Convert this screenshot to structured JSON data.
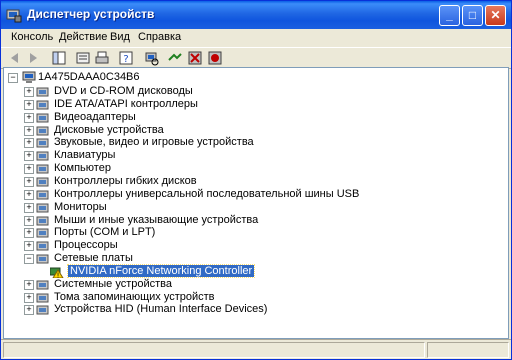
{
  "window": {
    "title": "Диспетчер устройств"
  },
  "menu": [
    "Консоль",
    "Действие",
    "Вид",
    "Справка"
  ],
  "toolbar": [
    "back-icon",
    "forward-icon",
    "console-tree-icon",
    "properties-icon",
    "print-icon",
    "help-icon",
    "scan-hardware-icon",
    "update-driver-icon",
    "disable-device-icon",
    "uninstall-device-icon"
  ],
  "tree": {
    "root": "1A475DAAA0C34B6",
    "items": [
      {
        "label": "DVD и CD-ROM дисководы",
        "icon": "dvd-icon"
      },
      {
        "label": "IDE ATA/ATAPI контроллеры",
        "icon": "ide-controller-icon"
      },
      {
        "label": "Видеоадаптеры",
        "icon": "display-adapter-icon"
      },
      {
        "label": "Дисковые устройства",
        "icon": "disk-drive-icon"
      },
      {
        "label": "Звуковые, видео и игровые устройства",
        "icon": "sound-icon"
      },
      {
        "label": "Клавиатуры",
        "icon": "keyboard-icon"
      },
      {
        "label": "Компьютер",
        "icon": "computer-icon"
      },
      {
        "label": "Контроллеры гибких дисков",
        "icon": "floppy-controller-icon"
      },
      {
        "label": "Контроллеры универсальной последовательной шины USB",
        "icon": "usb-icon"
      },
      {
        "label": "Мониторы",
        "icon": "monitor-icon"
      },
      {
        "label": "Мыши и иные указывающие устройства",
        "icon": "mouse-icon"
      },
      {
        "label": "Порты (COM и LPT)",
        "icon": "port-icon"
      },
      {
        "label": "Процессоры",
        "icon": "processor-icon"
      },
      {
        "label": "Сетевые платы",
        "icon": "network-adapter-icon",
        "expanded": true
      },
      {
        "label": "NVIDIA nForce Networking Controller",
        "icon": "warning-device-icon",
        "child": true,
        "selected": true
      },
      {
        "label": "Системные устройства",
        "icon": "system-device-icon"
      },
      {
        "label": "Тома запоминающих устройств",
        "icon": "storage-volume-icon"
      },
      {
        "label": "Устройства HID (Human Interface Devices)",
        "icon": "hid-icon"
      }
    ]
  },
  "colors": {
    "titlebar": "#0a5fe6",
    "selection": "#316ac5",
    "warning": "#ffd700"
  }
}
